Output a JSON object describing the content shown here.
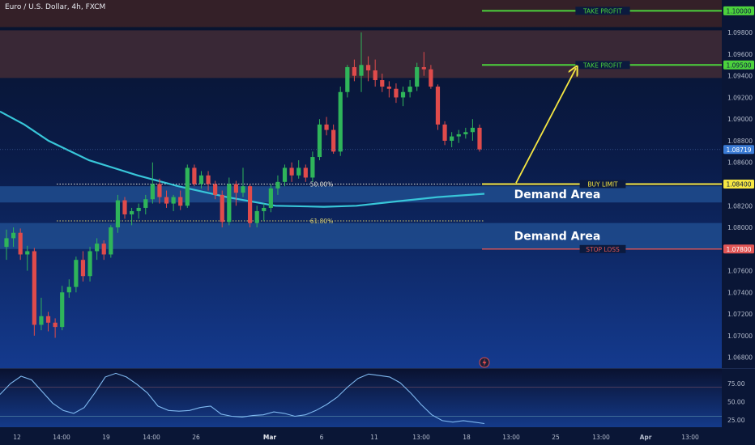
{
  "header": {
    "symbol": "Euro / U.S. Dollar, 4h, FXCM"
  },
  "chart_data": {
    "type": "candlestick",
    "price_axis": {
      "ticks": [
        "1.09800",
        "1.09600",
        "1.09400",
        "1.09200",
        "1.09000",
        "1.08800",
        "1.08600",
        "1.08200",
        "1.08000",
        "1.07600",
        "1.07400",
        "1.07200",
        "1.07000",
        "1.06800"
      ],
      "ylim": [
        1.067,
        1.101
      ],
      "current_price": "1.08719"
    },
    "time_axis": {
      "ticks": [
        "12",
        "14:00",
        "19",
        "14:00",
        "26",
        "Mar",
        "6",
        "11",
        "13:00",
        "18",
        "13:00",
        "25",
        "13:00",
        "Apr",
        "13:00"
      ]
    },
    "zones": [
      {
        "name": "resistance-zone-top",
        "from": 1.0985,
        "to": 1.101,
        "color": "#3a2228"
      },
      {
        "name": "resistance-zone",
        "from": 1.0938,
        "to": 1.0982,
        "color": "#3f2a36"
      },
      {
        "name": "demand-area-1",
        "from": 1.0823,
        "to": 1.0838,
        "label": "Demand Area",
        "color": "#1e4a8c"
      },
      {
        "name": "demand-area-2",
        "from": 1.078,
        "to": 1.0804,
        "label": "Demand Area",
        "color": "#1e4a8c"
      }
    ],
    "levels": [
      {
        "name": "take-profit-2",
        "price": 1.1,
        "label": "TAKE PROFIT",
        "axis_label": "1.10000",
        "color": "#4cd23c"
      },
      {
        "name": "take-profit-1",
        "price": 1.095,
        "label": "TAKE PROFIT",
        "axis_label": "1.09500",
        "color": "#4cd23c"
      },
      {
        "name": "buy-limit",
        "price": 1.084,
        "label": "BUY LIMIT",
        "axis_label": "1.08400",
        "color": "#f5e642"
      },
      {
        "name": "stop-loss",
        "price": 1.078,
        "label": "STOP LOSS",
        "axis_label": "1.07800",
        "color": "#e05555"
      }
    ],
    "fib_levels": [
      {
        "label": "50.00%",
        "price": 1.084
      },
      {
        "label": "61.80%",
        "price": 1.0806
      }
    ],
    "candles": [
      [
        1.0782,
        1.0798,
        1.077,
        1.079
      ],
      [
        1.079,
        1.08,
        1.0782,
        1.0795
      ],
      [
        1.0795,
        1.0799,
        1.077,
        1.0775
      ],
      [
        1.0775,
        1.0783,
        1.076,
        1.0778
      ],
      [
        1.0778,
        1.0781,
        1.07,
        1.071
      ],
      [
        1.071,
        1.0735,
        1.0705,
        1.0718
      ],
      [
        1.0718,
        1.0722,
        1.0704,
        1.0712
      ],
      [
        1.0712,
        1.0716,
        1.0698,
        1.0708
      ],
      [
        1.0708,
        1.0746,
        1.0705,
        1.074
      ],
      [
        1.074,
        1.0752,
        1.0735,
        1.0745
      ],
      [
        1.0745,
        1.0773,
        1.074,
        1.077
      ],
      [
        1.077,
        1.0778,
        1.075,
        1.0755
      ],
      [
        1.0755,
        1.0782,
        1.075,
        1.0778
      ],
      [
        1.0778,
        1.079,
        1.077,
        1.0785
      ],
      [
        1.0785,
        1.0788,
        1.077,
        1.0775
      ],
      [
        1.0775,
        1.0802,
        1.0772,
        1.08
      ],
      [
        1.08,
        1.083,
        1.0795,
        1.0825
      ],
      [
        1.0825,
        1.0828,
        1.0808,
        1.0812
      ],
      [
        1.0812,
        1.0818,
        1.0802,
        1.0815
      ],
      [
        1.0815,
        1.0822,
        1.0808,
        1.0818
      ],
      [
        1.0818,
        1.083,
        1.0812,
        1.0826
      ],
      [
        1.0826,
        1.086,
        1.0822,
        1.084
      ],
      [
        1.084,
        1.0845,
        1.0822,
        1.0828
      ],
      [
        1.0828,
        1.0834,
        1.0818,
        1.0822
      ],
      [
        1.0822,
        1.083,
        1.0815,
        1.0828
      ],
      [
        1.0828,
        1.0834,
        1.0816,
        1.082
      ],
      [
        1.082,
        1.0858,
        1.0818,
        1.0855
      ],
      [
        1.0855,
        1.0858,
        1.0838,
        1.084
      ],
      [
        1.084,
        1.0852,
        1.0836,
        1.0848
      ],
      [
        1.0848,
        1.0852,
        1.0834,
        1.084
      ],
      [
        1.084,
        1.0843,
        1.0826,
        1.083
      ],
      [
        1.083,
        1.0834,
        1.08,
        1.0805
      ],
      [
        1.0805,
        1.0846,
        1.0802,
        1.084
      ],
      [
        1.084,
        1.0843,
        1.082,
        1.0832
      ],
      [
        1.0832,
        1.0855,
        1.0828,
        1.0838
      ],
      [
        1.0838,
        1.084,
        1.08,
        1.0804
      ],
      [
        1.0804,
        1.082,
        1.08,
        1.0815
      ],
      [
        1.0815,
        1.0822,
        1.0806,
        1.0818
      ],
      [
        1.0818,
        1.084,
        1.0814,
        1.0836
      ],
      [
        1.0836,
        1.0848,
        1.083,
        1.0842
      ],
      [
        1.0842,
        1.0858,
        1.0838,
        1.0855
      ],
      [
        1.0855,
        1.086,
        1.0842,
        1.0848
      ],
      [
        1.0848,
        1.0862,
        1.0845,
        1.0855
      ],
      [
        1.0855,
        1.0858,
        1.0842,
        1.0846
      ],
      [
        1.0846,
        1.087,
        1.0842,
        1.0865
      ],
      [
        1.0865,
        1.09,
        1.0862,
        1.0895
      ],
      [
        1.0895,
        1.0902,
        1.0885,
        1.089
      ],
      [
        1.089,
        1.0895,
        1.0868,
        1.087
      ],
      [
        1.087,
        1.093,
        1.0866,
        1.0925
      ],
      [
        1.0925,
        1.095,
        1.092,
        1.0948
      ],
      [
        1.0948,
        1.0955,
        1.0935,
        1.094
      ],
      [
        1.094,
        1.098,
        1.0925,
        1.095
      ],
      [
        1.095,
        1.0958,
        1.0935,
        1.0945
      ],
      [
        1.0945,
        1.0955,
        1.093,
        1.0936
      ],
      [
        1.0936,
        1.0942,
        1.0925,
        1.093
      ],
      [
        1.093,
        1.0935,
        1.092,
        1.0928
      ],
      [
        1.0928,
        1.0933,
        1.0915,
        1.092
      ],
      [
        1.092,
        1.093,
        1.0912,
        1.0925
      ],
      [
        1.0925,
        1.0936,
        1.092,
        1.093
      ],
      [
        1.093,
        1.0952,
        1.0926,
        1.0948
      ],
      [
        1.0948,
        1.0962,
        1.094,
        1.0946
      ],
      [
        1.0946,
        1.095,
        1.0928,
        1.093
      ],
      [
        1.093,
        1.0932,
        1.089,
        1.0895
      ],
      [
        1.0895,
        1.0898,
        1.0876,
        1.088
      ],
      [
        1.088,
        1.0888,
        1.0874,
        1.0884
      ],
      [
        1.0884,
        1.089,
        1.0878,
        1.0886
      ],
      [
        1.0886,
        1.0892,
        1.0882,
        1.0888
      ],
      [
        1.0888,
        1.09,
        1.088,
        1.0892
      ],
      [
        1.0892,
        1.0895,
        1.087,
        1.0872
      ]
    ],
    "ema": [
      [
        0,
        1.0907
      ],
      [
        30,
        1.0895
      ],
      [
        60,
        1.088
      ],
      [
        110,
        1.0862
      ],
      [
        170,
        1.0848
      ],
      [
        220,
        1.0838
      ],
      [
        280,
        1.0828
      ],
      [
        340,
        1.082
      ],
      [
        400,
        1.0819
      ],
      [
        440,
        1.082
      ],
      [
        490,
        1.0824
      ],
      [
        540,
        1.0828
      ],
      [
        598,
        1.0831
      ]
    ],
    "oscillator": {
      "ticks": [
        "75.00",
        "50.00",
        "25.00"
      ],
      "ylim": [
        15,
        95
      ],
      "upper": 70,
      "lower": 30,
      "values": [
        60,
        75,
        85,
        80,
        64,
        48,
        38,
        34,
        42,
        62,
        84,
        89,
        84,
        74,
        62,
        44,
        38,
        37,
        38,
        42,
        44,
        33,
        30,
        29,
        31,
        32,
        36,
        34,
        30,
        32,
        38,
        46,
        56,
        70,
        82,
        88,
        86,
        84,
        76,
        62,
        46,
        32,
        24,
        22,
        24,
        22,
        20
      ]
    },
    "annotations": [
      {
        "name": "demand-label-1",
        "text": "Demand Area"
      },
      {
        "name": "demand-label-2",
        "text": "Demand Area"
      }
    ]
  }
}
